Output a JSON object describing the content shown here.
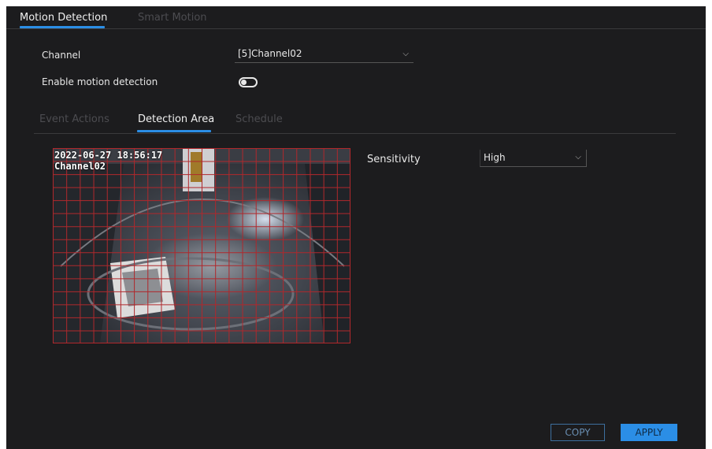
{
  "top_tabs": [
    {
      "label": "Motion Detection",
      "active": true
    },
    {
      "label": "Smart Motion",
      "active": false
    }
  ],
  "channel": {
    "label": "Channel",
    "value": "[5]Channel02"
  },
  "enable_motion": {
    "label": "Enable motion detection",
    "enabled": false
  },
  "sub_tabs": [
    {
      "label": "Event Actions",
      "active": false
    },
    {
      "label": "Detection Area",
      "active": true
    },
    {
      "label": "Schedule",
      "active": false
    }
  ],
  "video": {
    "timestamp": "2022-06-27 18:56:17",
    "osd_channel": "Channel02",
    "grid_color": "#b0282c",
    "grid_columns": 22,
    "grid_rows": 15
  },
  "sensitivity": {
    "label": "Sensitivity",
    "value": "High"
  },
  "buttons": {
    "copy": "COPY",
    "apply": "APPLY"
  },
  "colors": {
    "accent": "#2b8ee6",
    "background": "#1c1c1e"
  }
}
